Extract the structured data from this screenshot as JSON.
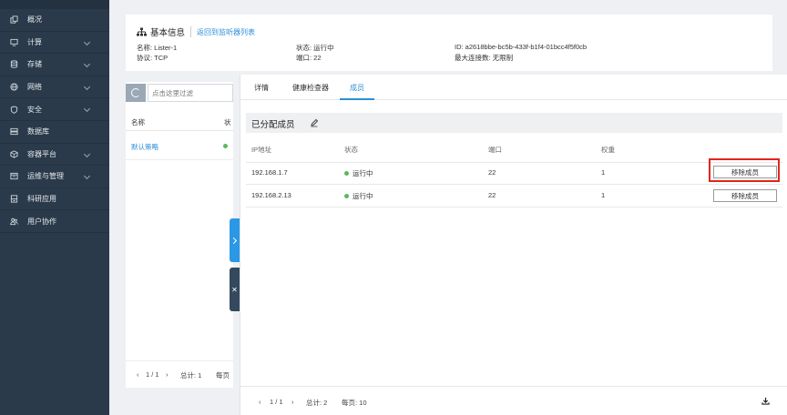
{
  "sidebar": {
    "items": [
      {
        "label": "概况",
        "icon": "copy-icon",
        "has_children": false
      },
      {
        "label": "计算",
        "icon": "monitor-icon",
        "has_children": true
      },
      {
        "label": "存储",
        "icon": "database-icon",
        "has_children": true
      },
      {
        "label": "网络",
        "icon": "globe-icon",
        "has_children": true
      },
      {
        "label": "安全",
        "icon": "shield-icon",
        "has_children": true
      },
      {
        "label": "数据库",
        "icon": "server-icon",
        "has_children": false
      },
      {
        "label": "容器平台",
        "icon": "container-icon",
        "has_children": true
      },
      {
        "label": "运维与管理",
        "icon": "window-icon",
        "has_children": true
      },
      {
        "label": "科研应用",
        "icon": "lab-icon",
        "has_children": false
      },
      {
        "label": "用户协作",
        "icon": "users-icon",
        "has_children": false
      }
    ]
  },
  "header": {
    "title": "基本信息",
    "back_link": "返回到监听器列表",
    "name": "名称: Lister-1",
    "protocol": "协议: TCP",
    "status": "状态: 运行中",
    "port": "端口: 22",
    "id": "ID: a2618bbe-bc5b-433f-b1f4-01bcc4f5f0cb",
    "max_conn": "最大连接数: 无限制"
  },
  "list_panel": {
    "search_placeholder": "点击这里过滤",
    "col_name": "名称",
    "col_status": "状",
    "row_name": "默认策略",
    "pager_arrows_left": "‹",
    "page_info": "1 / 1",
    "pager_arrows_right": "›",
    "total": "总计:  1",
    "per_page": "每页"
  },
  "drawer": {
    "tabs": [
      "详情",
      "健康检查器",
      "成员"
    ],
    "active_tab": 2,
    "section_title": "已分配成员",
    "columns": [
      "IP地址",
      "状态",
      "端口",
      "权重"
    ],
    "rows": [
      {
        "ip": "192.168.1.7",
        "status": "运行中",
        "port": "22",
        "weight": "1",
        "action": "移除成员"
      },
      {
        "ip": "192.168.2.13",
        "status": "运行中",
        "port": "22",
        "weight": "1",
        "action": "移除成员"
      }
    ],
    "footer": {
      "prev": "‹",
      "page_info": "1 / 1",
      "next": "›",
      "total": "总计:  2",
      "per_page": "每页:  10"
    }
  },
  "colors": {
    "sidebar_bg": "#2b3a4a",
    "accent": "#2b8fd8",
    "running": "#5cb85c",
    "highlight": "#e0261b"
  }
}
